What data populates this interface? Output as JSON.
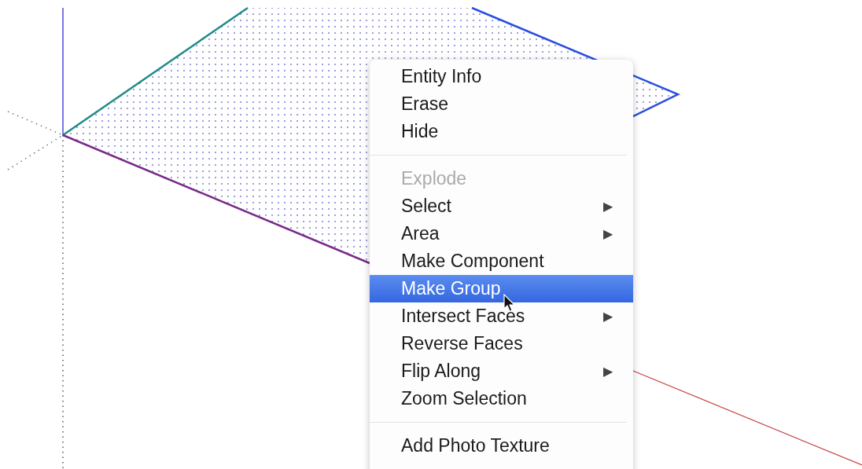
{
  "context_menu": {
    "items": [
      {
        "kind": "item",
        "label": "Entity Info",
        "disabled": false,
        "selected": false
      },
      {
        "kind": "item",
        "label": "Erase",
        "disabled": false,
        "selected": false
      },
      {
        "kind": "item",
        "label": "Hide",
        "disabled": false,
        "selected": false
      },
      {
        "kind": "separator"
      },
      {
        "kind": "item",
        "label": "Explode",
        "disabled": true,
        "selected": false
      },
      {
        "kind": "item",
        "label": "Select",
        "disabled": false,
        "selected": false,
        "arrow": "▶"
      },
      {
        "kind": "item",
        "label": "Area",
        "disabled": false,
        "selected": false,
        "arrow": "▶"
      },
      {
        "kind": "item",
        "label": "Make Component",
        "disabled": false,
        "selected": false
      },
      {
        "kind": "item",
        "label": "Make Group",
        "disabled": false,
        "selected": true
      },
      {
        "kind": "item",
        "label": "Intersect Faces",
        "disabled": false,
        "selected": false,
        "arrow": "▶"
      },
      {
        "kind": "item",
        "label": "Reverse Faces",
        "disabled": false,
        "selected": false
      },
      {
        "kind": "item",
        "label": "Flip Along",
        "disabled": false,
        "selected": false,
        "arrow": "▶"
      },
      {
        "kind": "item",
        "label": "Zoom Selection",
        "disabled": false,
        "selected": false
      },
      {
        "kind": "separator"
      },
      {
        "kind": "item",
        "label": "Add Photo Texture",
        "disabled": false,
        "selected": false
      }
    ]
  }
}
